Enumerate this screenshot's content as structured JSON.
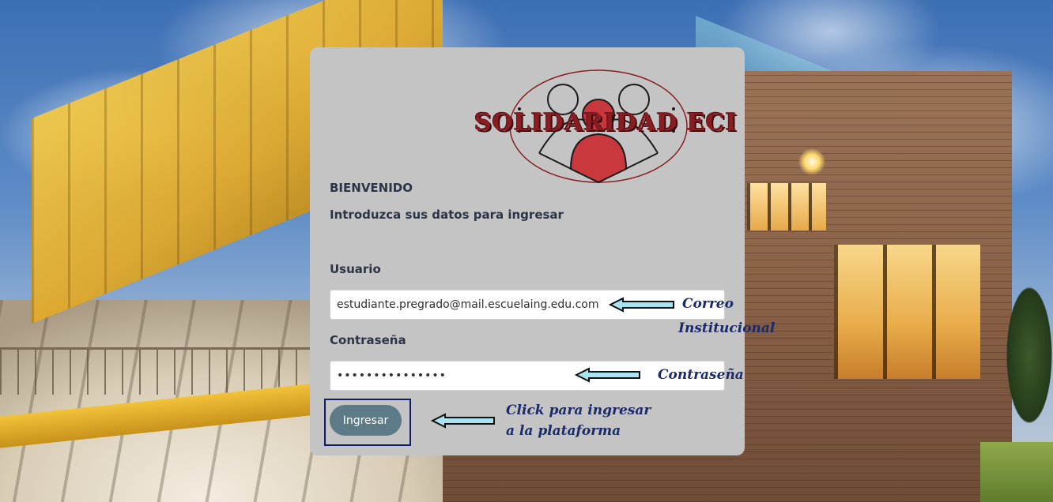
{
  "login": {
    "logo_text": "SOLIDARIDAD ECI",
    "welcome": "BIENVENIDO",
    "subtitle": "Introduzca sus datos para ingresar",
    "user_label": "Usuario",
    "user_value": "estudiante.pregrado@mail.escuelaing.edu.com",
    "password_label": "Contraseña",
    "password_mask": "•••••••••••••••",
    "submit_label": "Ingresar"
  },
  "annotations": {
    "email_line1": "Correo",
    "email_line2": "Institucional",
    "password": "Contraseña",
    "submit_line1": "Click para ingresar",
    "submit_line2": "a la plataforma"
  },
  "colors": {
    "card_bg": "#c4c4c4",
    "button_bg": "#5d7b87",
    "annotation_text": "#1b2a68",
    "logo_red": "#8a1d22"
  },
  "icons": {
    "annotation_arrow": "left-arrow-icon",
    "logo_figures": "people-emblem-icon"
  }
}
